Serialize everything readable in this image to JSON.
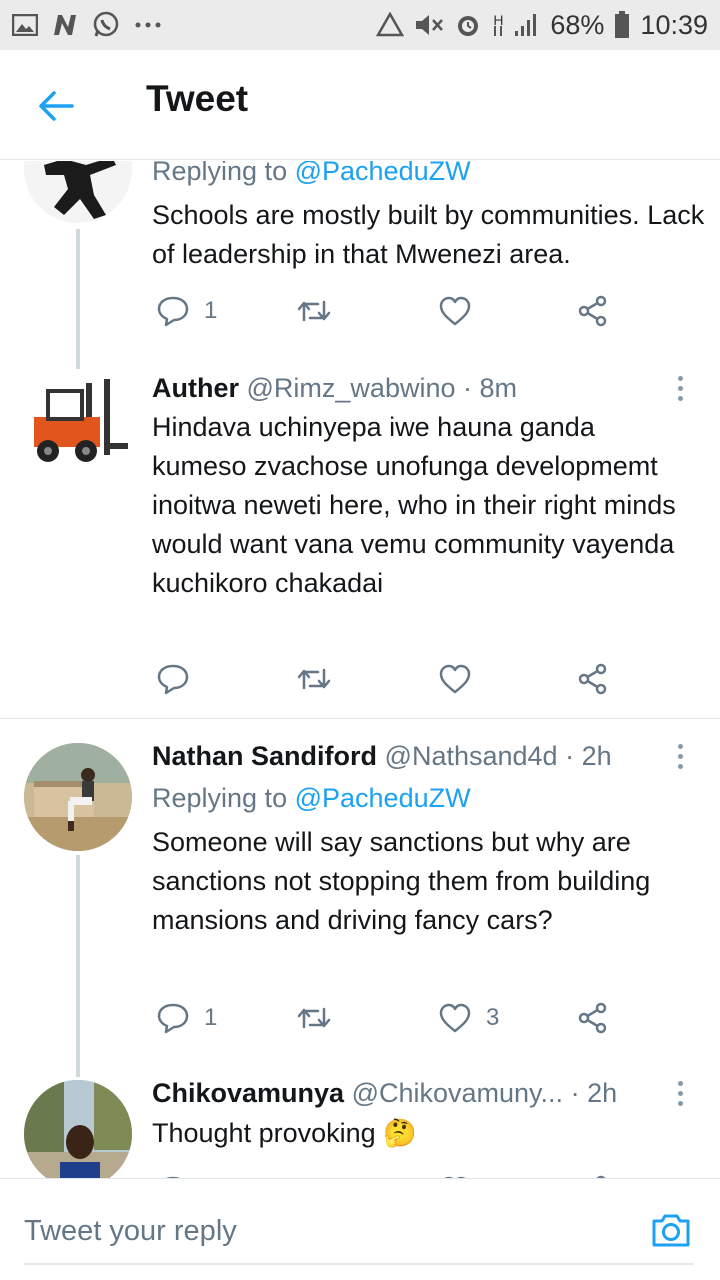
{
  "status_bar": {
    "battery_percent": "68%",
    "time": "10:39",
    "network": "H",
    "icons": [
      "gallery-icon",
      "news-icon",
      "whatsapp-icon",
      "more-dots-icon",
      "recycle-icon",
      "mute-icon",
      "alarm-icon",
      "network-icon",
      "signal-icon",
      "battery-icon"
    ]
  },
  "header": {
    "title": "Tweet",
    "back_icon": "arrow-left-icon"
  },
  "tweets": [
    {
      "replying_label": "Replying to",
      "replying_handle": "@PacheduZW",
      "text": "Schools are mostly built by communities. Lack of leadership in that Mwenezi area.",
      "reply_count": "1",
      "retweet_count": "",
      "like_count": ""
    },
    {
      "name": "Auther",
      "handle": "@Rimz_wabwino",
      "time": "· 8m",
      "text": "Hindava uchinyepa iwe hauna ganda kumeso zvachose unofunga developmemt inoitwa neweti here, who in their right minds would want vana vemu community vayenda kuchikoro chakadai",
      "reply_count": "",
      "retweet_count": "",
      "like_count": ""
    },
    {
      "name": "Nathan Sandiford",
      "handle": "@Nathsand4d",
      "time": "· 2h",
      "replying_label": "Replying to",
      "replying_handle": "@PacheduZW",
      "text": "Someone will say sanctions but why are sanctions not stopping them from building mansions and driving fancy cars?",
      "reply_count": "1",
      "retweet_count": "",
      "like_count": "3"
    },
    {
      "name": "Chikovamunya",
      "handle": "@Chikovamuny...",
      "time": "· 2h",
      "text": "Thought provoking 🤔"
    }
  ],
  "composer": {
    "placeholder": "Tweet your reply",
    "camera_icon": "camera-icon"
  },
  "colors": {
    "accent": "#1da1f2",
    "secondary_text": "#657786",
    "primary_text": "#14171a",
    "divider": "#e1e8ed"
  }
}
